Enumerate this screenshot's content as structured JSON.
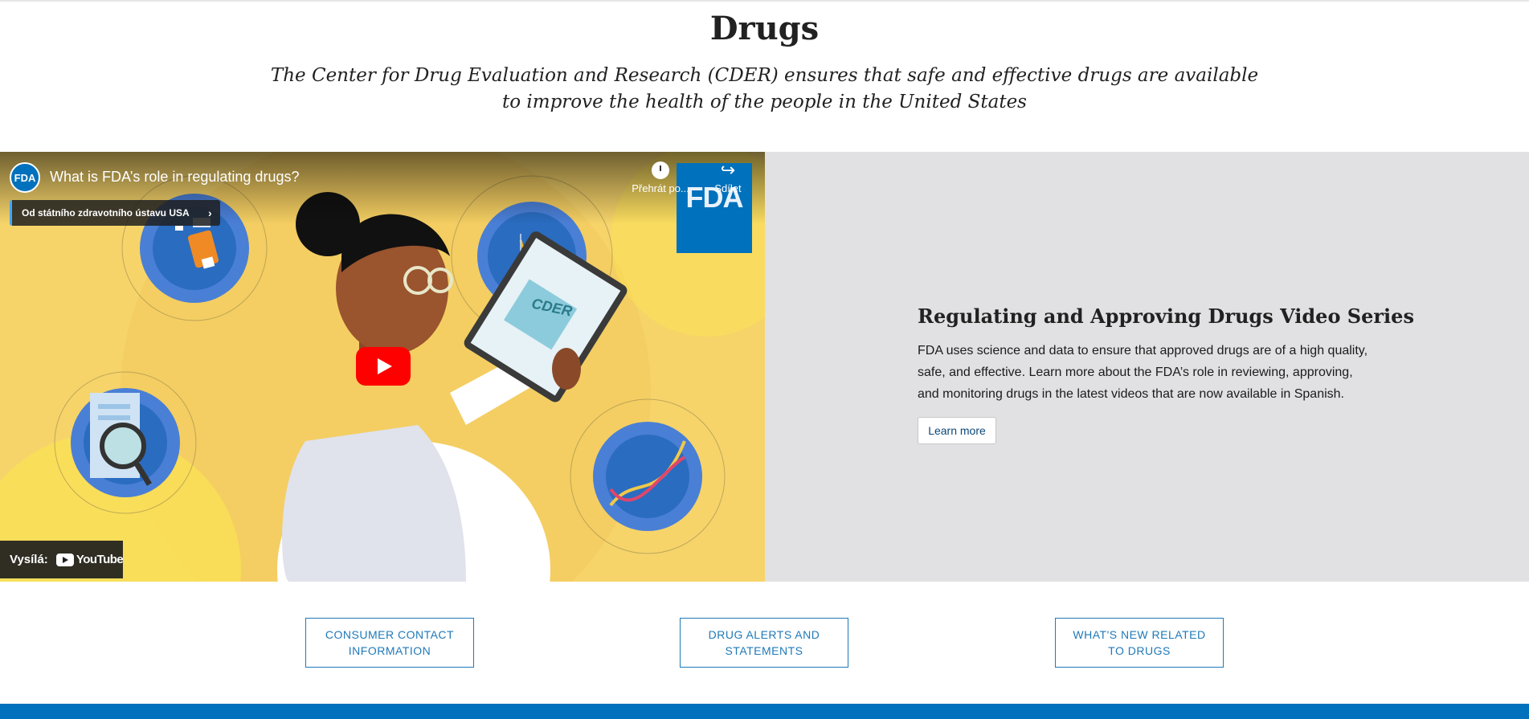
{
  "header": {
    "title": "Drugs",
    "subtitle": "The Center for Drug Evaluation and Research (CDER) ensures that safe and effective drugs are available to improve the health of the people in the United States"
  },
  "video": {
    "channel_logo_text": "FDA",
    "title": "What is FDA’s role in regulating drugs?",
    "info_chip": "Od státního zdravotního ústavu USA",
    "watch_later_label": "Přehrát po...",
    "share_label": "Sdílet",
    "fda_tile_text": "FDA",
    "tablet_text": "CDER",
    "badge_prefix": "Vysílá:",
    "badge_brand": "YouTube",
    "colors": {
      "play": "#ff0000",
      "background": "#f6d46a",
      "circle": "#4a7fd6",
      "fda_blue": "#0071bc"
    }
  },
  "series": {
    "title": "Regulating and Approving Drugs Video Series",
    "description": "FDA uses science and data to ensure that approved drugs are of a high quality, safe, and effective. Learn more about the FDA’s role in reviewing, approving, and monitoring drugs in the latest videos that are now available in Spanish.",
    "learn_more_label": "Learn more"
  },
  "links": [
    {
      "label": "CONSUMER CONTACT INFORMATION"
    },
    {
      "label": "DRUG ALERTS AND STATEMENTS"
    },
    {
      "label": "WHAT'S NEW RELATED TO DRUGS"
    }
  ],
  "theme": {
    "link_color": "#1f79b8",
    "footer_bar": "#0071bc",
    "panel_bg": "#e1e1e3"
  }
}
